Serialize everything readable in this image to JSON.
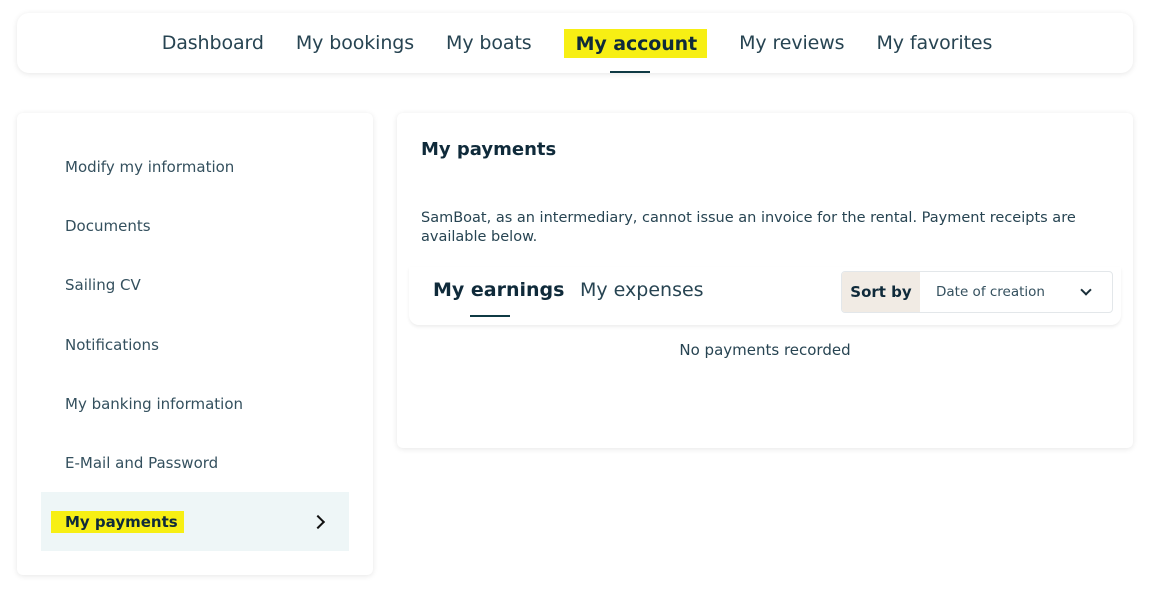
{
  "topnav": {
    "items": [
      {
        "label": "Dashboard"
      },
      {
        "label": "My bookings"
      },
      {
        "label": "My boats"
      },
      {
        "label": "My account",
        "active": true
      },
      {
        "label": "My reviews"
      },
      {
        "label": "My favorites"
      }
    ]
  },
  "sidebar": {
    "items": [
      {
        "label": "Modify my information"
      },
      {
        "label": "Documents"
      },
      {
        "label": "Sailing CV"
      },
      {
        "label": "Notifications"
      },
      {
        "label": "My banking information"
      },
      {
        "label": "E-Mail and Password"
      },
      {
        "label": "My payments",
        "active": true
      }
    ]
  },
  "main": {
    "title": "My payments",
    "description": "SamBoat, as an intermediary, cannot issue an invoice for the rental. Payment receipts are available below.",
    "tabs": [
      {
        "label": "My earnings",
        "active": true
      },
      {
        "label": "My expenses"
      }
    ],
    "sort": {
      "label": "Sort by",
      "value": "Date of creation"
    },
    "empty_message": "No payments recorded"
  },
  "colors": {
    "highlight": "#f7ef14",
    "text_dark": "#0f2a3a",
    "active_bg": "#eef6f7"
  }
}
